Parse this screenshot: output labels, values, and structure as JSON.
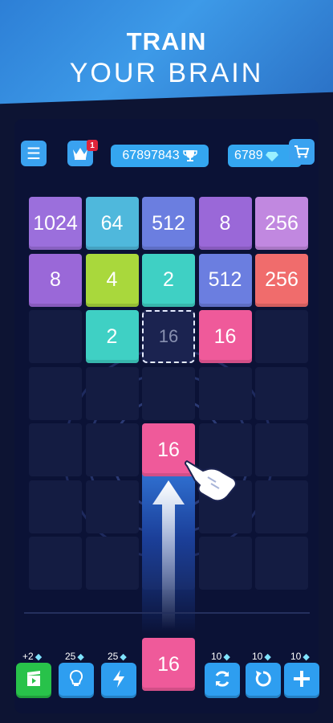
{
  "banner": {
    "line1": "TRAIN",
    "line2": "YOUR BRAIN"
  },
  "topbar": {
    "menu_icon": "hamburger-icon",
    "crown_badge": "1",
    "score": "67897843",
    "score_icon": "trophy-icon",
    "gems": "6789",
    "gems_icon": "diamond-icon",
    "cart_icon": "cart-icon"
  },
  "board": {
    "columns": 5,
    "rows": 7,
    "tiles": [
      {
        "row": 0,
        "col": 0,
        "value": "1024",
        "color": "#9b6fdc"
      },
      {
        "row": 0,
        "col": 1,
        "value": "64",
        "color": "#4fb8dc"
      },
      {
        "row": 0,
        "col": 2,
        "value": "512",
        "color": "#6b7ee0"
      },
      {
        "row": 0,
        "col": 3,
        "value": "8",
        "color": "#9a68d8"
      },
      {
        "row": 0,
        "col": 4,
        "value": "256",
        "color": "#c188e0"
      },
      {
        "row": 1,
        "col": 0,
        "value": "8",
        "color": "#9a68d8"
      },
      {
        "row": 1,
        "col": 1,
        "value": "4",
        "color": "#a9d83c"
      },
      {
        "row": 1,
        "col": 2,
        "value": "2",
        "color": "#3fd0c4"
      },
      {
        "row": 1,
        "col": 3,
        "value": "512",
        "color": "#6b7ee0"
      },
      {
        "row": 1,
        "col": 4,
        "value": "256",
        "color": "#f06c6c"
      },
      {
        "row": 2,
        "col": 1,
        "value": "2",
        "color": "#3fd0c4"
      },
      {
        "row": 2,
        "col": 3,
        "value": "16",
        "color": "#ef5a9a"
      }
    ],
    "ghost": {
      "row": 2,
      "col": 2,
      "value": "16"
    }
  },
  "shooter": {
    "current_value": "16",
    "next_value": "16",
    "color": "#ef5a9a"
  },
  "tools": [
    {
      "name": "video-tool",
      "cost": "+2",
      "icon": "video-icon",
      "color": "#28c24a"
    },
    {
      "name": "hint-tool",
      "cost": "25",
      "icon": "lightbulb-icon",
      "color": "#2e9ef0"
    },
    {
      "name": "lightning-tool",
      "cost": "25",
      "icon": "lightning-icon",
      "color": "#2e9ef0"
    },
    {
      "name": "shuffle-tool",
      "cost": "10",
      "icon": "refresh-icon",
      "color": "#2e9ef0"
    },
    {
      "name": "undo-tool",
      "cost": "10",
      "icon": "undo-icon",
      "color": "#2e9ef0"
    },
    {
      "name": "add-tool",
      "cost": "10",
      "icon": "plus-icon",
      "color": "#2e9ef0"
    }
  ]
}
